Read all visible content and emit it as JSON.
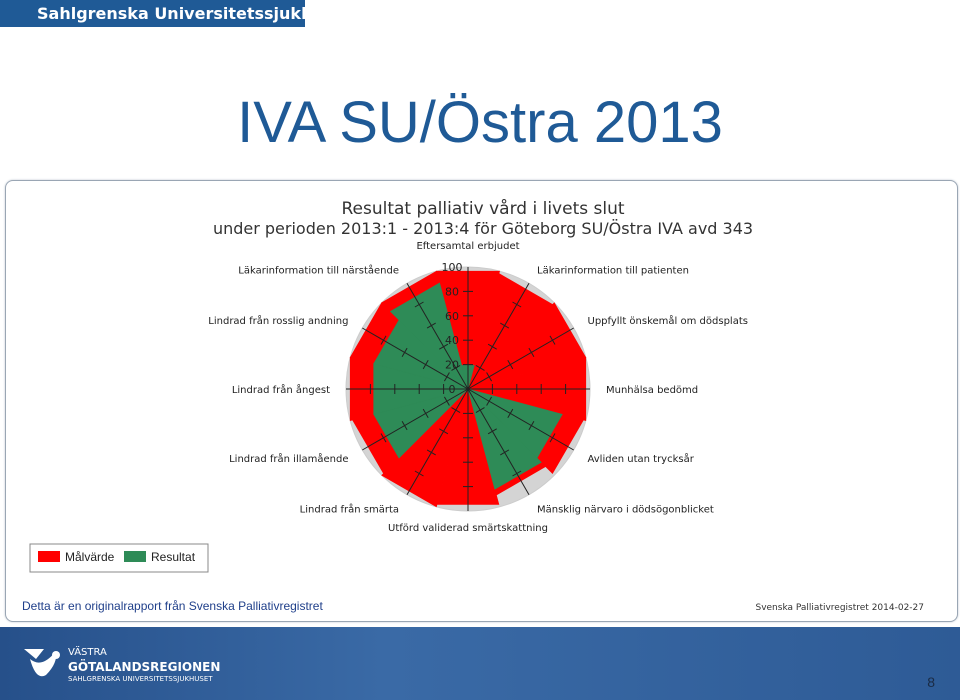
{
  "header": {
    "org_name": "Sahlgrenska Universitetssjukhuset",
    "title": "IVA SU/Östra 2013"
  },
  "chart_data": {
    "type": "radar",
    "title": "Resultat palliativ vård i livets slut",
    "subtitle": "under perioden 2013:1 - 2013:4 för Göteborg SU/Östra IVA avd 343",
    "ylim": [
      0,
      100
    ],
    "yticks": [
      "0",
      "20",
      "40",
      "60",
      "80",
      "100"
    ],
    "categories": [
      "Eftersamtal erbjudet",
      "Läkarinformation till patienten",
      "Uppfyllt önskemål om dödsplats",
      "Munhälsa bedömd",
      "Avliden utan trycksår",
      "Mänsklig närvaro i dödsögonblicket",
      "Utförd validerad smärtskattning",
      "Lindrad från smärta",
      "Lindrad från illamående",
      "Lindrad från ångest",
      "Lindrad från rosslig andning",
      "Läkarinformation till närstående"
    ],
    "series": [
      {
        "name": "Målvärde",
        "color": "#ff0000",
        "values": [
          100,
          98,
          100,
          100,
          98,
          90,
          98,
          100,
          98,
          100,
          100,
          100
        ]
      },
      {
        "name": "Resultat",
        "color": "#2e8b57",
        "values": [
          20,
          0,
          0,
          0,
          80,
          85,
          0,
          0,
          80,
          80,
          80,
          90
        ]
      }
    ],
    "legend_position": "bottom-left",
    "grid": true
  },
  "footer": {
    "source_note": "Detta är en originalrapport från Svenska Palliativregistret",
    "report_date": "Svenska Palliativregistret 2014-02-27",
    "logo_line1": "VÄSTRA",
    "logo_line2": "GÖTALANDSREGIONEN",
    "logo_line3": "SAHLGRENSKA UNIVERSITETSSJUKHUSET",
    "page_number": "8"
  },
  "colors": {
    "brand_blue": "#1f5a96",
    "target_red": "#ff0000",
    "result_green": "#2e8b57"
  }
}
